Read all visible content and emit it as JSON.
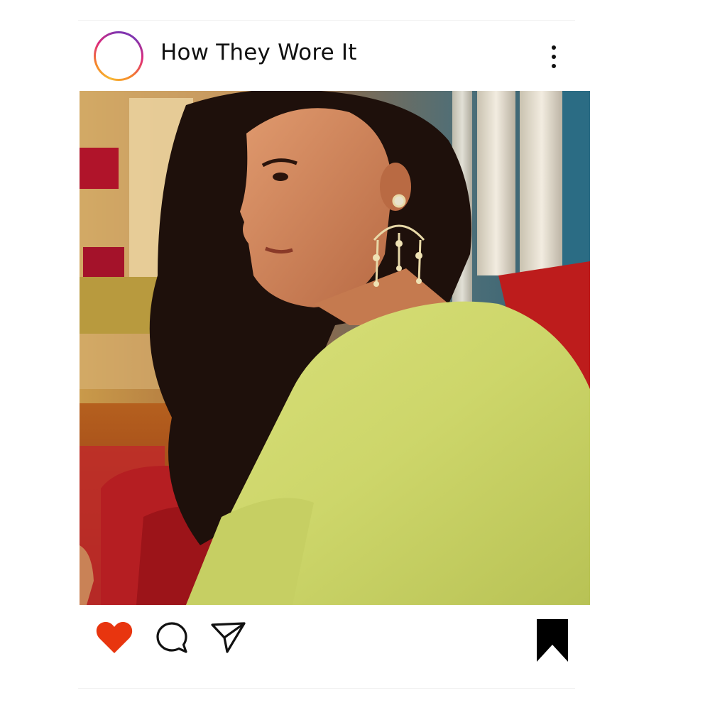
{
  "post": {
    "username": "How They Wore It",
    "photo_description_icon": "photo",
    "liked": true
  },
  "icons": {
    "more": "more-vertical-icon",
    "like": "heart-icon",
    "comment": "comment-icon",
    "share": "send-icon",
    "save": "bookmark-icon"
  },
  "colors": {
    "heart": "#e8350f",
    "text": "#111111",
    "story_ring_start": "#f7b733",
    "story_ring_end": "#8134af"
  }
}
